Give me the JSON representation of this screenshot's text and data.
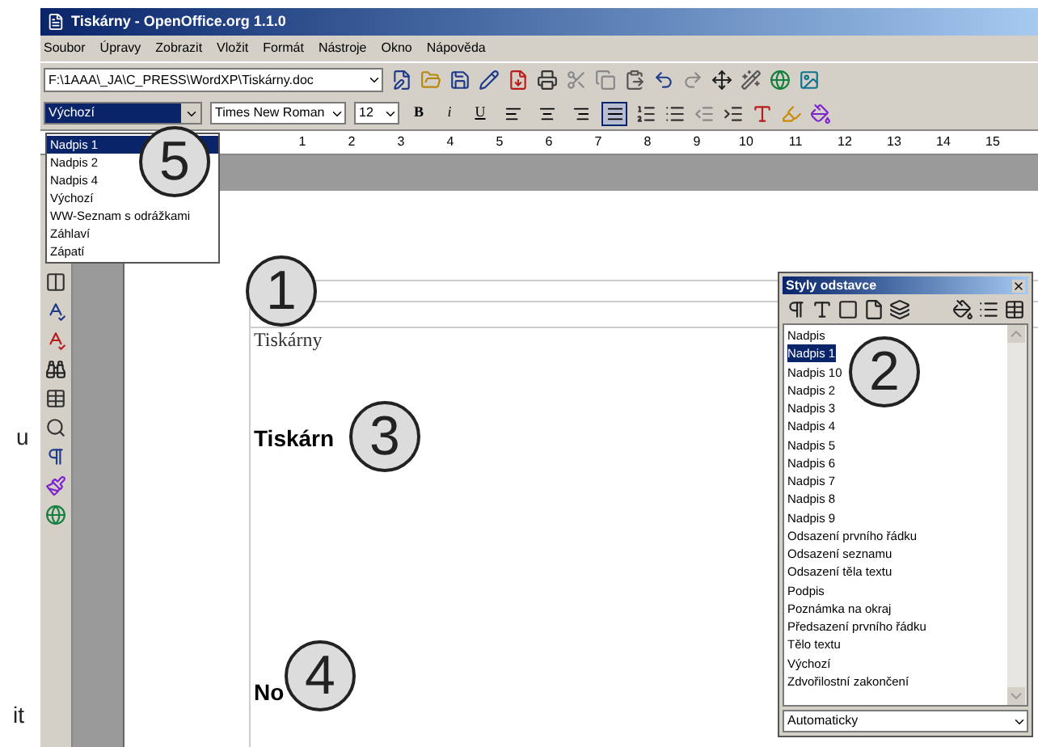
{
  "margin_text": [
    "u",
    "it"
  ],
  "window": {
    "title": "Tiskárny - OpenOffice.org 1.1.0"
  },
  "menu": [
    "Soubor",
    "Úpravy",
    "Zobrazit",
    "Vložit",
    "Formát",
    "Nástroje",
    "Okno",
    "Nápověda"
  ],
  "address": {
    "value": "F:\\1AAA\\_JA\\C_PRESS\\WordXP\\Tiskárny.doc"
  },
  "format_bar": {
    "style": "Výchozí",
    "font": "Times New Roman",
    "size": "12",
    "text_buttons": [
      "B",
      "i",
      "U"
    ],
    "align": [
      {
        "selected": false
      },
      {
        "selected": false
      },
      {
        "selected": false
      },
      {
        "selected": true
      }
    ]
  },
  "style_dropdown": [
    {
      "label": "Nadpis 1",
      "selected": true
    },
    {
      "label": "Nadpis 2",
      "selected": false
    },
    {
      "label": "Nadpis 4",
      "selected": false
    },
    {
      "label": "Výchozí",
      "selected": false
    },
    {
      "label": "WW-Seznam s odrážkami",
      "selected": false
    },
    {
      "label": "Záhlaví",
      "selected": false
    },
    {
      "label": "Zápatí",
      "selected": false
    }
  ],
  "ruler": [
    "1",
    "2",
    "3",
    "4",
    "5",
    "6",
    "7",
    "8",
    "9",
    "10",
    "11",
    "12",
    "13",
    "14",
    "15"
  ],
  "document": {
    "header": "Tiskárny",
    "heading": "Tiskárn",
    "heading2": "No"
  },
  "styles_panel": {
    "title": "Styly odstavce",
    "filter": "Automaticky",
    "items": [
      {
        "label": "Nadpis",
        "selected": false
      },
      {
        "label": "Nadpis 1",
        "selected": true
      },
      {
        "label": "Nadpis 10",
        "selected": false
      },
      {
        "label": "Nadpis 2",
        "selected": false
      },
      {
        "label": "Nadpis 3",
        "selected": false
      },
      {
        "label": "Nadpis 4",
        "selected": false
      },
      {
        "label": "Nadpis 5",
        "selected": false
      },
      {
        "label": "Nadpis 6",
        "selected": false
      },
      {
        "label": "Nadpis 7",
        "selected": false
      },
      {
        "label": "Nadpis 8",
        "selected": false
      },
      {
        "label": "Nadpis 9",
        "selected": false
      },
      {
        "label": "Odsazení prvního řádku",
        "selected": false
      },
      {
        "label": "Odsazení seznamu",
        "selected": false
      },
      {
        "label": "Odsazení těla textu",
        "selected": false
      },
      {
        "label": "Podpis",
        "selected": false
      },
      {
        "label": "Poznámka na okraj",
        "selected": false
      },
      {
        "label": "Předsazení prvního řádku",
        "selected": false
      },
      {
        "label": "Tělo textu",
        "selected": false
      },
      {
        "label": "Výchozí",
        "selected": false
      },
      {
        "label": "Zdvořilostní zakončení",
        "selected": false
      }
    ]
  },
  "callouts": [
    "1",
    "2",
    "3",
    "4",
    "5"
  ]
}
